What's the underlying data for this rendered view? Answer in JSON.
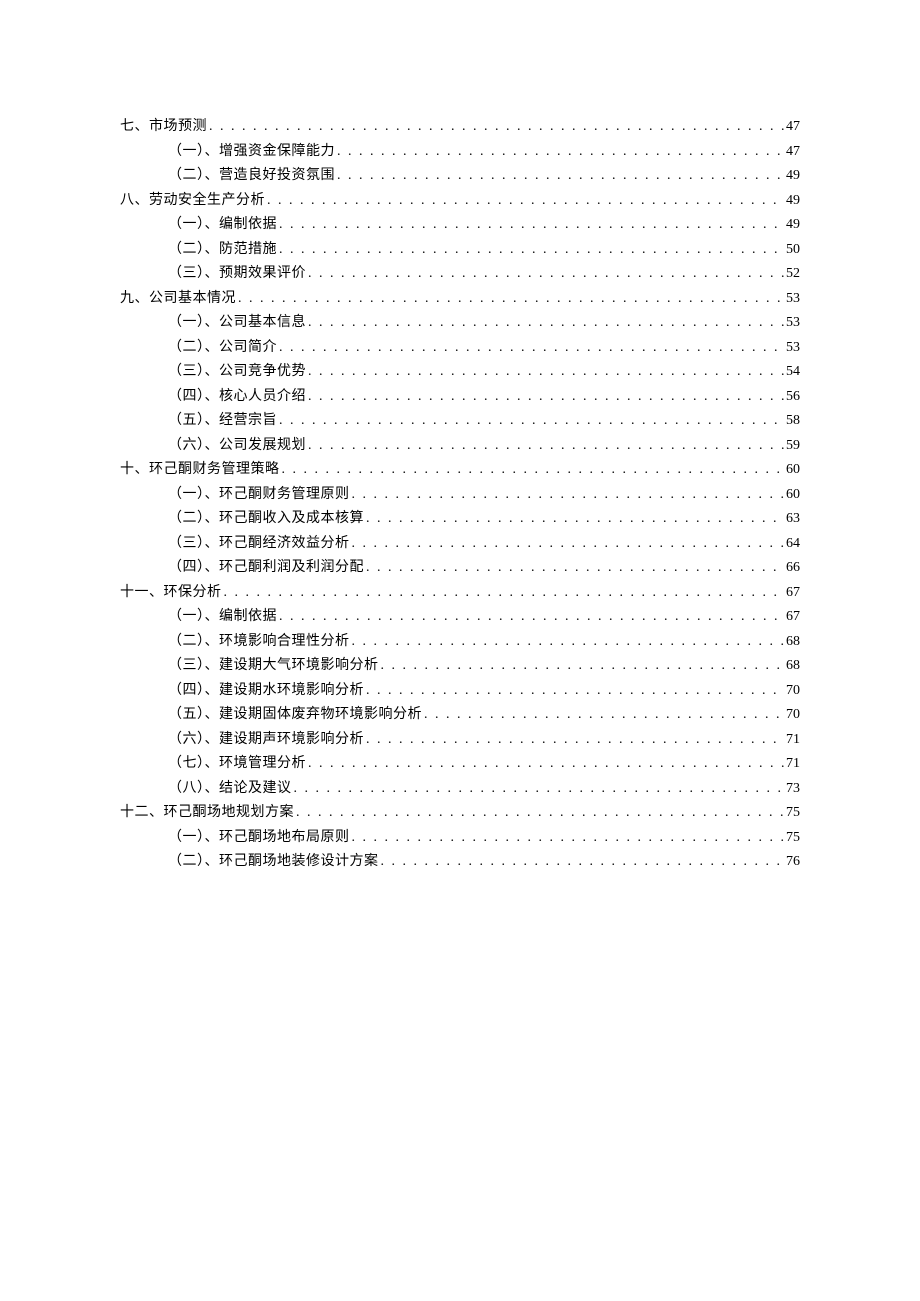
{
  "toc": [
    {
      "level": 1,
      "label": "七、市场预测",
      "page": "47"
    },
    {
      "level": 2,
      "label": "（一）、增强资金保障能力",
      "page": "47"
    },
    {
      "level": 2,
      "label": "（二）、营造良好投资氛围",
      "page": "49"
    },
    {
      "level": 1,
      "label": "八、劳动安全生产分析",
      "page": "49"
    },
    {
      "level": 2,
      "label": "（一）、编制依据",
      "page": "49"
    },
    {
      "level": 2,
      "label": "（二）、防范措施",
      "page": "50"
    },
    {
      "level": 2,
      "label": "（三）、预期效果评价",
      "page": "52"
    },
    {
      "level": 1,
      "label": "九、公司基本情况",
      "page": "53"
    },
    {
      "level": 2,
      "label": "（一）、公司基本信息",
      "page": "53"
    },
    {
      "level": 2,
      "label": "（二）、公司简介",
      "page": "53"
    },
    {
      "level": 2,
      "label": "（三）、公司竞争优势",
      "page": "54"
    },
    {
      "level": 2,
      "label": "（四）、核心人员介绍",
      "page": "56"
    },
    {
      "level": 2,
      "label": "（五）、经营宗旨",
      "page": "58"
    },
    {
      "level": 2,
      "label": "（六）、公司发展规划",
      "page": "59"
    },
    {
      "level": 1,
      "label": "十、环己酮财务管理策略",
      "page": "60"
    },
    {
      "level": 2,
      "label": "（一）、环己酮财务管理原则",
      "page": "60"
    },
    {
      "level": 2,
      "label": "（二）、环己酮收入及成本核算",
      "page": "63"
    },
    {
      "level": 2,
      "label": "（三）、环己酮经济效益分析",
      "page": "64"
    },
    {
      "level": 2,
      "label": "（四）、环己酮利润及利润分配",
      "page": "66"
    },
    {
      "level": 1,
      "label": "十一、环保分析",
      "page": "67"
    },
    {
      "level": 2,
      "label": "（一）、编制依据",
      "page": "67"
    },
    {
      "level": 2,
      "label": "（二）、环境影响合理性分析",
      "page": "68"
    },
    {
      "level": 2,
      "label": "（三）、建设期大气环境影响分析",
      "page": "68"
    },
    {
      "level": 2,
      "label": "（四）、建设期水环境影响分析",
      "page": "70"
    },
    {
      "level": 2,
      "label": "（五）、建设期固体废弃物环境影响分析",
      "page": "70"
    },
    {
      "level": 2,
      "label": "（六）、建设期声环境影响分析",
      "page": "71"
    },
    {
      "level": 2,
      "label": "（七）、环境管理分析",
      "page": "71"
    },
    {
      "level": 2,
      "label": "（八）、结论及建议",
      "page": "73"
    },
    {
      "level": 1,
      "label": "十二、环己酮场地规划方案",
      "page": "75"
    },
    {
      "level": 2,
      "label": "（一）、环己酮场地布局原则",
      "page": "75"
    },
    {
      "level": 2,
      "label": "（二）、环己酮场地装修设计方案",
      "page": "76"
    }
  ]
}
